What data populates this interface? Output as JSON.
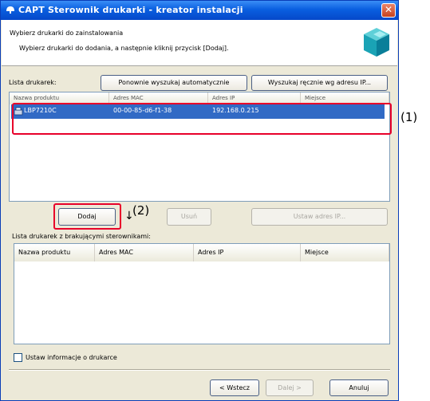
{
  "window": {
    "title": "CAPT Sterownik drukarki - kreator instalacji",
    "close_glyph": "✕"
  },
  "header": {
    "title": "Wybierz drukarki do zainstalowania",
    "subtitle": "Wybierz drukarki do dodania, a następnie kliknij przycisk [Dodaj].",
    "icon": "printer-cube-icon"
  },
  "printer_list": {
    "label": "Lista drukarek:",
    "auto_search_button": "Ponownie wyszukaj automatycznie",
    "manual_search_button": "Wyszukaj ręcznie wg adresu IP...",
    "columns": [
      "Nazwa produktu",
      "Adres MAC",
      "Adres IP",
      "Miejsce"
    ],
    "rows": [
      {
        "name": "LBP7210C",
        "mac": "00-00-85-d6-f1-38",
        "ip": "192.168.0.215",
        "location": ""
      }
    ]
  },
  "actions": {
    "add_button": "Dodaj",
    "remove_button": "Usuń",
    "set_ip_button": "Ustaw adres IP..."
  },
  "missing_drivers": {
    "label": "Lista drukarek z brakującymi sterownikami:",
    "columns": [
      "Nazwa produktu",
      "Adres MAC",
      "Adres IP",
      "Miejsce"
    ]
  },
  "printer_info_checkbox": {
    "label": "Ustaw informacje o drukarce",
    "checked": false
  },
  "footer": {
    "back_button": "< Wstecz",
    "next_button": "Dalej >",
    "cancel_button": "Anuluj"
  },
  "annotations": {
    "callout_1": "(1)",
    "callout_2": "(2)",
    "arrow": "↓",
    "highlight_color": "#e8002a"
  }
}
